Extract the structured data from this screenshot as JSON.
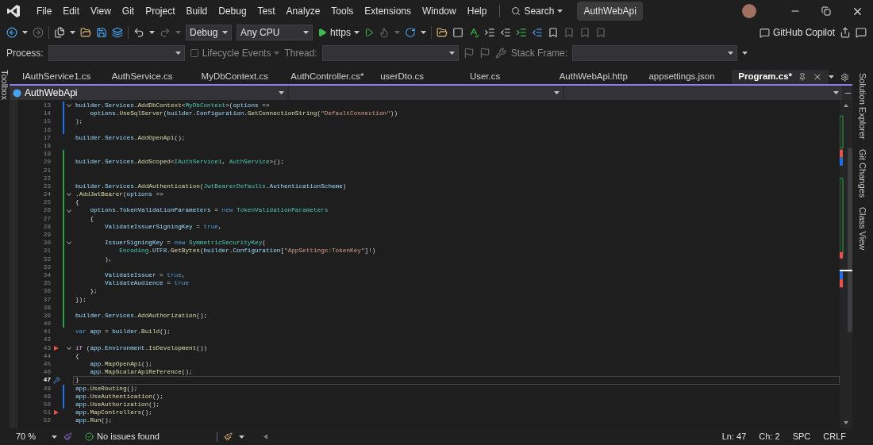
{
  "menu": {
    "items": [
      "File",
      "Edit",
      "View",
      "Git",
      "Project",
      "Build",
      "Debug",
      "Test",
      "Analyze",
      "Tools",
      "Extensions",
      "Window",
      "Help"
    ],
    "search": "Search",
    "solution": "AuthWebApi"
  },
  "toolbar": {
    "configuration": "Debug",
    "platform": "Any CPU",
    "run_target": "https",
    "copilot": "GitHub Copilot"
  },
  "debug_toolbar": {
    "process_label": "Process:",
    "lifecycle": "Lifecycle Events",
    "thread_label": "Thread:",
    "stack_frame_label": "Stack Frame:"
  },
  "side_left": [
    "Toolbox"
  ],
  "side_right": [
    "Solution Explorer",
    "Git Changes",
    "Class View"
  ],
  "tabs": [
    {
      "label": "IAuthService1.cs",
      "selected": false
    },
    {
      "label": "AuthService.cs",
      "selected": false
    },
    {
      "label": "MyDbContext.cs",
      "selected": false
    },
    {
      "label": "AuthController.cs*",
      "selected": false
    },
    {
      "label": "userDto.cs",
      "selected": false
    },
    {
      "label": "User.cs",
      "selected": false
    },
    {
      "label": "AuthWebApi.http",
      "selected": false
    },
    {
      "label": "appsettings.json",
      "selected": false
    },
    {
      "label": "Program.cs*",
      "selected": true
    }
  ],
  "nav_bar": {
    "project": "AuthWebApi"
  },
  "editor": {
    "lines": [
      {
        "number": "13",
        "fold": true,
        "marker": false,
        "current": false,
        "color": "#1f6feb",
        "tokens": [
          {
            "kind": "var",
            "text": "builder"
          },
          {
            "kind": "plain",
            "text": "."
          },
          {
            "kind": "var",
            "text": "Services"
          },
          {
            "kind": "plain",
            "text": "."
          },
          {
            "kind": "method",
            "text": "AddDbContext"
          },
          {
            "kind": "plain",
            "text": "<"
          },
          {
            "kind": "type",
            "text": "MyDbContext"
          },
          {
            "kind": "plain",
            "text": ">("
          },
          {
            "kind": "var",
            "text": "options"
          },
          {
            "kind": "plain",
            "text": " =>"
          }
        ]
      },
      {
        "number": "14",
        "fold": false,
        "marker": false,
        "current": false,
        "color": "#1f6feb",
        "tokens": [
          {
            "kind": "var",
            "text": "    options"
          },
          {
            "kind": "plain",
            "text": "."
          },
          {
            "kind": "method",
            "text": "UseSqlServer"
          },
          {
            "kind": "plain",
            "text": "("
          },
          {
            "kind": "var",
            "text": "builder"
          },
          {
            "kind": "plain",
            "text": "."
          },
          {
            "kind": "var",
            "text": "Configuration"
          },
          {
            "kind": "plain",
            "text": "."
          },
          {
            "kind": "method",
            "text": "GetConnectionString"
          },
          {
            "kind": "plain",
            "text": "("
          },
          {
            "kind": "string",
            "text": "\"DefaultConnection\""
          },
          {
            "kind": "plain",
            "text": "))"
          }
        ]
      },
      {
        "number": "15",
        "fold": false,
        "marker": false,
        "current": false,
        "color": "#1f6feb",
        "tokens": [
          {
            "kind": "plain",
            "text": ");"
          }
        ]
      },
      {
        "number": "16",
        "fold": false,
        "marker": false,
        "current": false,
        "color": "#1f6feb"
      },
      {
        "number": "17",
        "fold": false,
        "marker": false,
        "current": false,
        "tokens": [
          {
            "kind": "var",
            "text": "builder"
          },
          {
            "kind": "plain",
            "text": "."
          },
          {
            "kind": "var",
            "text": "Services"
          },
          {
            "kind": "plain",
            "text": "."
          },
          {
            "kind": "method",
            "text": "AddOpenApi"
          },
          {
            "kind": "plain",
            "text": "();"
          }
        ]
      },
      {
        "number": "18",
        "fold": false,
        "marker": false,
        "current": false
      },
      {
        "number": "19",
        "fold": false,
        "marker": false,
        "current": false,
        "color": "#2ea043"
      },
      {
        "number": "20",
        "fold": false,
        "marker": false,
        "current": false,
        "color": "#2ea043",
        "tokens": [
          {
            "kind": "var",
            "text": "builder"
          },
          {
            "kind": "plain",
            "text": "."
          },
          {
            "kind": "var",
            "text": "Services"
          },
          {
            "kind": "plain",
            "text": "."
          },
          {
            "kind": "method",
            "text": "AddScoped"
          },
          {
            "kind": "plain",
            "text": "<"
          },
          {
            "kind": "type",
            "text": "IAuthService1"
          },
          {
            "kind": "plain",
            "text": ", "
          },
          {
            "kind": "type",
            "text": "AuthService"
          },
          {
            "kind": "plain",
            "text": ">();"
          }
        ]
      },
      {
        "number": "21",
        "fold": false,
        "marker": false,
        "current": false,
        "color": "#2ea043"
      },
      {
        "number": "22",
        "fold": false,
        "marker": false,
        "current": false,
        "color": "#2ea043"
      },
      {
        "number": "23",
        "fold": false,
        "marker": false,
        "current": false,
        "color": "#2ea043",
        "tokens": [
          {
            "kind": "var",
            "text": "builder"
          },
          {
            "kind": "plain",
            "text": "."
          },
          {
            "kind": "var",
            "text": "Services"
          },
          {
            "kind": "plain",
            "text": "."
          },
          {
            "kind": "method",
            "text": "AddAuthentication"
          },
          {
            "kind": "plain",
            "text": "("
          },
          {
            "kind": "type",
            "text": "JwtBearerDefaults"
          },
          {
            "kind": "plain",
            "text": "."
          },
          {
            "kind": "var",
            "text": "AuthenticationScheme"
          },
          {
            "kind": "plain",
            "text": ")"
          }
        ]
      },
      {
        "number": "24",
        "fold": true,
        "marker": false,
        "current": false,
        "color": "#2ea043",
        "tokens": [
          {
            "kind": "plain",
            "text": "."
          },
          {
            "kind": "method",
            "text": "AddJwtBearer"
          },
          {
            "kind": "plain",
            "text": "("
          },
          {
            "kind": "var",
            "text": "options"
          },
          {
            "kind": "plain",
            "text": " =>"
          }
        ]
      },
      {
        "number": "25",
        "fold": false,
        "marker": false,
        "current": false,
        "color": "#2ea043",
        "tokens": [
          {
            "kind": "plain",
            "text": "{"
          }
        ]
      },
      {
        "number": "26",
        "fold": true,
        "marker": false,
        "current": false,
        "color": "#2ea043",
        "tokens": [
          {
            "kind": "var",
            "text": "    options"
          },
          {
            "kind": "plain",
            "text": "."
          },
          {
            "kind": "var",
            "text": "TokenValidationParameters"
          },
          {
            "kind": "plain",
            "text": " = "
          },
          {
            "kind": "keyword",
            "text": "new "
          },
          {
            "kind": "type",
            "text": "TokenValidationParameters"
          }
        ]
      },
      {
        "number": "27",
        "fold": false,
        "marker": false,
        "current": false,
        "color": "#2ea043",
        "tokens": [
          {
            "kind": "plain",
            "text": "    {"
          }
        ]
      },
      {
        "number": "28",
        "fold": false,
        "marker": false,
        "current": false,
        "color": "#2ea043",
        "tokens": [
          {
            "kind": "var",
            "text": "        ValidateIssuerSigningKey"
          },
          {
            "kind": "plain",
            "text": " = "
          },
          {
            "kind": "keyword",
            "text": "true"
          },
          {
            "kind": "plain",
            "text": ","
          }
        ]
      },
      {
        "number": "29",
        "fold": false,
        "marker": false,
        "current": false,
        "color": "#2ea043"
      },
      {
        "number": "30",
        "fold": true,
        "marker": false,
        "current": false,
        "color": "#2ea043",
        "tokens": [
          {
            "kind": "var",
            "text": "        IssuerSigningKey"
          },
          {
            "kind": "plain",
            "text": " = "
          },
          {
            "kind": "keyword",
            "text": "new "
          },
          {
            "kind": "type",
            "text": "SymmetricSecurityKey"
          },
          {
            "kind": "plain",
            "text": "("
          }
        ]
      },
      {
        "number": "31",
        "fold": false,
        "marker": false,
        "current": false,
        "color": "#2ea043",
        "tokens": [
          {
            "kind": "type",
            "text": "            Encoding"
          },
          {
            "kind": "plain",
            "text": "."
          },
          {
            "kind": "var",
            "text": "UTF8"
          },
          {
            "kind": "plain",
            "text": "."
          },
          {
            "kind": "method",
            "text": "GetBytes"
          },
          {
            "kind": "plain",
            "text": "("
          },
          {
            "kind": "var",
            "text": "builder"
          },
          {
            "kind": "plain",
            "text": "."
          },
          {
            "kind": "var",
            "text": "Configuration"
          },
          {
            "kind": "plain",
            "text": "["
          },
          {
            "kind": "string",
            "text": "\"AppSettings:TokenKey\""
          },
          {
            "kind": "plain",
            "text": "]!)"
          }
        ]
      },
      {
        "number": "32",
        "fold": false,
        "marker": false,
        "current": false,
        "color": "#2ea043",
        "tokens": [
          {
            "kind": "plain",
            "text": "        ),"
          }
        ]
      },
      {
        "number": "33",
        "fold": false,
        "marker": false,
        "current": false,
        "color": "#2ea043"
      },
      {
        "number": "34",
        "fold": false,
        "marker": false,
        "current": false,
        "color": "#2ea043",
        "tokens": [
          {
            "kind": "var",
            "text": "        ValidateIssuer"
          },
          {
            "kind": "plain",
            "text": " = "
          },
          {
            "kind": "keyword",
            "text": "true"
          },
          {
            "kind": "plain",
            "text": ","
          }
        ]
      },
      {
        "number": "35",
        "fold": false,
        "marker": false,
        "current": false,
        "color": "#2ea043",
        "tokens": [
          {
            "kind": "var",
            "text": "        ValidateAudience"
          },
          {
            "kind": "plain",
            "text": " = "
          },
          {
            "kind": "keyword",
            "text": "true"
          }
        ]
      },
      {
        "number": "36",
        "fold": false,
        "marker": false,
        "current": false,
        "color": "#2ea043",
        "tokens": [
          {
            "kind": "plain",
            "text": "    };"
          }
        ]
      },
      {
        "number": "37",
        "fold": false,
        "marker": false,
        "current": false,
        "color": "#2ea043",
        "tokens": [
          {
            "kind": "plain",
            "text": "});"
          }
        ]
      },
      {
        "number": "38",
        "fold": false,
        "marker": false,
        "current": false,
        "color": "#2ea043"
      },
      {
        "number": "39",
        "fold": false,
        "marker": false,
        "current": false,
        "color": "#2ea043",
        "tokens": [
          {
            "kind": "var",
            "text": "builder"
          },
          {
            "kind": "plain",
            "text": "."
          },
          {
            "kind": "var",
            "text": "Services"
          },
          {
            "kind": "plain",
            "text": "."
          },
          {
            "kind": "method",
            "text": "AddAuthorization"
          },
          {
            "kind": "plain",
            "text": "();"
          }
        ]
      },
      {
        "number": "40",
        "fold": false,
        "marker": false,
        "current": false,
        "color": "#2ea043"
      },
      {
        "number": "41",
        "fold": false,
        "marker": false,
        "current": false,
        "tokens": [
          {
            "kind": "keyword",
            "text": "var"
          },
          {
            "kind": "var",
            "text": " app"
          },
          {
            "kind": "plain",
            "text": " = "
          },
          {
            "kind": "var",
            "text": "builder"
          },
          {
            "kind": "plain",
            "text": "."
          },
          {
            "kind": "method",
            "text": "Build"
          },
          {
            "kind": "plain",
            "text": "();"
          }
        ]
      },
      {
        "number": "42",
        "fold": false,
        "marker": false,
        "current": false
      },
      {
        "number": "43",
        "fold": true,
        "marker": true,
        "current": false,
        "tokens": [
          {
            "kind": "control",
            "text": "if"
          },
          {
            "kind": "plain",
            "text": " ("
          },
          {
            "kind": "var",
            "text": "app"
          },
          {
            "kind": "plain",
            "text": "."
          },
          {
            "kind": "var",
            "text": "Environment"
          },
          {
            "kind": "plain",
            "text": "."
          },
          {
            "kind": "method",
            "text": "IsDevelopment"
          },
          {
            "kind": "plain",
            "text": "())"
          }
        ]
      },
      {
        "number": "44",
        "fold": false,
        "marker": false,
        "current": false,
        "tokens": [
          {
            "kind": "plain",
            "text": "{"
          }
        ]
      },
      {
        "number": "45",
        "fold": false,
        "marker": false,
        "current": false,
        "tokens": [
          {
            "kind": "var",
            "text": "    app"
          },
          {
            "kind": "plain",
            "text": "."
          },
          {
            "kind": "method",
            "text": "MapOpenApi"
          },
          {
            "kind": "plain",
            "text": "();"
          }
        ]
      },
      {
        "number": "46",
        "fold": false,
        "marker": false,
        "current": false,
        "tokens": [
          {
            "kind": "var",
            "text": "    app"
          },
          {
            "kind": "plain",
            "text": "."
          },
          {
            "kind": "method",
            "text": "MapScalarApiReference"
          },
          {
            "kind": "plain",
            "text": "();"
          }
        ]
      },
      {
        "number": "47",
        "fold": false,
        "marker": false,
        "current": true,
        "tokens": [
          {
            "kind": "plain",
            "text": "}"
          }
        ]
      },
      {
        "number": "48",
        "fold": false,
        "marker": false,
        "current": false,
        "color": "#1f6feb",
        "tokens": [
          {
            "kind": "var",
            "text": "app"
          },
          {
            "kind": "plain",
            "text": "."
          },
          {
            "kind": "method",
            "text": "UseRouting"
          },
          {
            "kind": "plain",
            "text": "();"
          }
        ]
      },
      {
        "number": "49",
        "fold": false,
        "marker": false,
        "current": false,
        "color": "#1f6feb",
        "tokens": [
          {
            "kind": "var",
            "text": "app"
          },
          {
            "kind": "plain",
            "text": "."
          },
          {
            "kind": "method",
            "text": "UseAuthentication"
          },
          {
            "kind": "plain",
            "text": "();"
          }
        ]
      },
      {
        "number": "50",
        "fold": false,
        "marker": false,
        "current": false,
        "color": "#1f6feb",
        "tokens": [
          {
            "kind": "var",
            "text": "app"
          },
          {
            "kind": "plain",
            "text": "."
          },
          {
            "kind": "method",
            "text": "UseAuthorization"
          },
          {
            "kind": "plain",
            "text": "();"
          }
        ]
      },
      {
        "number": "51",
        "fold": false,
        "marker": true,
        "current": false,
        "tokens": [
          {
            "kind": "var",
            "text": "app"
          },
          {
            "kind": "plain",
            "text": "."
          },
          {
            "kind": "method",
            "text": "MapControllers"
          },
          {
            "kind": "plain",
            "text": "();"
          }
        ]
      },
      {
        "number": "52",
        "fold": false,
        "marker": false,
        "current": false,
        "tokens": [
          {
            "kind": "var",
            "text": "app"
          },
          {
            "kind": "plain",
            "text": "."
          },
          {
            "kind": "method",
            "text": "Run"
          },
          {
            "kind": "plain",
            "text": "();"
          }
        ]
      }
    ]
  },
  "status_bar": {
    "zoom": "70 %",
    "issues": "No issues found",
    "line": "Ln: 47",
    "column": "Ch: 2",
    "whitespace": "SPC",
    "line_ending": "CRLF"
  }
}
